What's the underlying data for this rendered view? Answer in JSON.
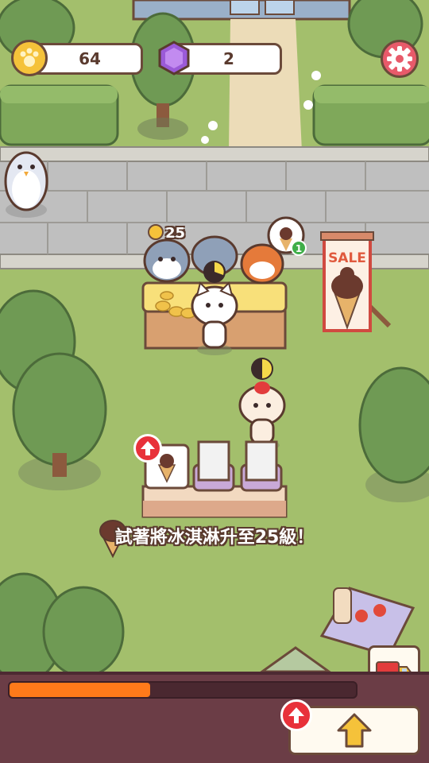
{
  "currency": {
    "coins": "64",
    "gems": "2"
  },
  "customer_coin_popup": "25",
  "order_badge_count": "1",
  "sale_sign_text": "SALE",
  "hint_text": "試著將冰淇淋升至25級！",
  "progress": {
    "fraction": 0.405
  },
  "icons": {
    "coin": "paw-coin-icon",
    "gem": "purple-gem-icon",
    "settings": "gear-icon",
    "delivery": "delivery-truck-icon",
    "upgrade": "up-arrow-icon",
    "upgrade_badge": "red-up-arrow-badge-icon"
  },
  "colors": {
    "accent_orange": "#ff7a1a",
    "panel_bg": "#6b3d46",
    "outline": "#5a3a2e",
    "badge_red": "#e8313a"
  }
}
